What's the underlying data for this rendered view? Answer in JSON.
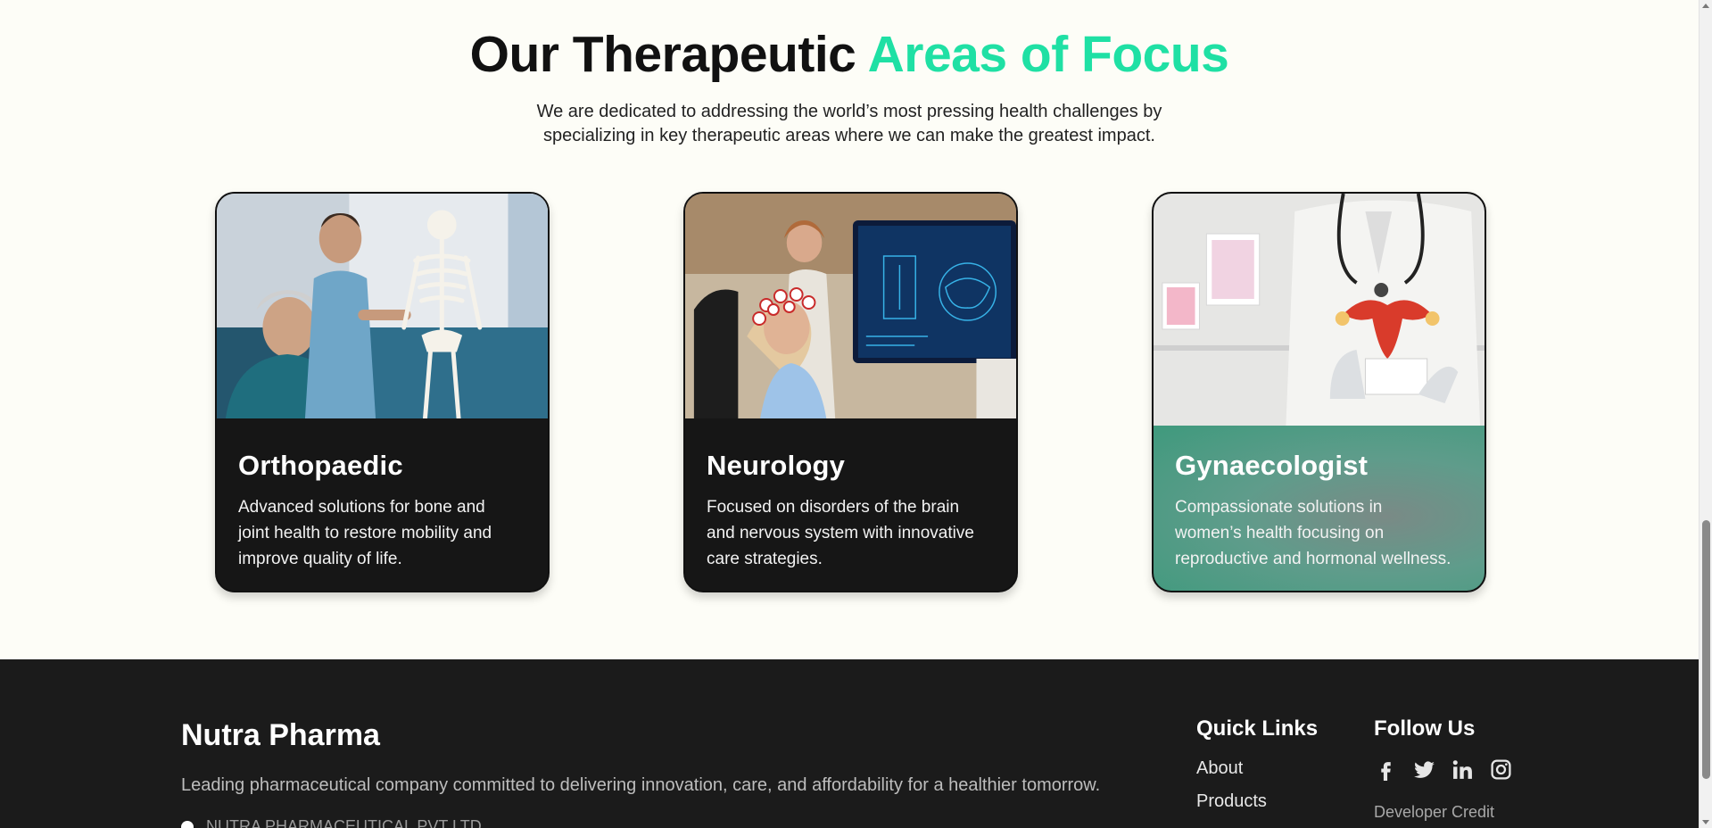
{
  "section": {
    "title_main": "Our Therapeutic ",
    "title_accent": "Areas of Focus",
    "subtitle_line1": "We are dedicated to addressing the world’s most pressing health challenges by",
    "subtitle_line2": "specializing in key therapeutic areas where we can make the greatest impact.",
    "accent_color": "#1fe0a4"
  },
  "cards": [
    {
      "title": "Orthopaedic",
      "desc_lines": [
        "Advanced solutions for bone and",
        "joint health to restore mobility and",
        "improve quality of life."
      ],
      "image": "doctor-with-skeleton-model"
    },
    {
      "title": "Neurology",
      "desc_lines": [
        "Focused on disorders of the brain",
        "and nervous system with innovative",
        "care strategies."
      ],
      "image": "eeg-cap-brain-scan-monitor"
    },
    {
      "title": "Gynaecologist",
      "desc_lines": [
        "Compassionate solutions in",
        "women’s health focusing on",
        "reproductive and hormonal wellness."
      ],
      "image": "doctor-holding-uterus-model",
      "highlight_color": "#3f9a7d"
    }
  ],
  "footer": {
    "brand": "Nutra Pharma",
    "tagline": "Leading pharmaceutical company committed to delivering innovation, care, and affordability for a healthier tomorrow.",
    "address": "NUTRA PHARMACEUTICAL PVT LTD",
    "quick_links_title": "Quick Links",
    "quick_links": [
      "About",
      "Products"
    ],
    "follow_title": "Follow Us",
    "socials": [
      "facebook-icon",
      "twitter-icon",
      "linkedin-icon",
      "instagram-icon"
    ],
    "developer_credit": "Developer Credit"
  }
}
